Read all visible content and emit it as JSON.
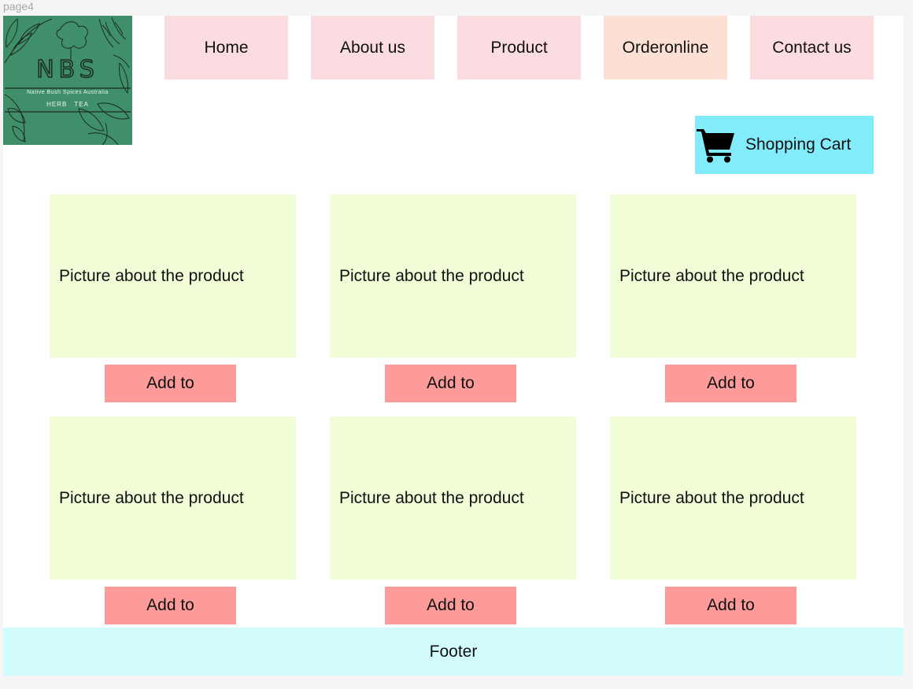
{
  "frame": {
    "label": "page4"
  },
  "logo": {
    "brand": "NBS",
    "tagline": "Native Bush Spices Australia",
    "subtitle": "HERB TEA"
  },
  "nav": {
    "items": [
      {
        "label": "Home"
      },
      {
        "label": "About us"
      },
      {
        "label": "Product"
      },
      {
        "label": "Orderonline"
      },
      {
        "label": "Contact us"
      }
    ]
  },
  "cart": {
    "label": "Shopping Cart",
    "icon": "shopping-cart-icon"
  },
  "products": [
    {
      "placeholder": "Picture about the product",
      "button": "Add to"
    },
    {
      "placeholder": "Picture about the product",
      "button": "Add to"
    },
    {
      "placeholder": "Picture about the product",
      "button": "Add to"
    },
    {
      "placeholder": "Picture about the product",
      "button": "Add to"
    },
    {
      "placeholder": "Picture about the product",
      "button": "Add to"
    },
    {
      "placeholder": "Picture about the product",
      "button": "Add to"
    }
  ],
  "footer": {
    "label": "Footer"
  },
  "colors": {
    "nav": "#fbdde1",
    "nav_active": "#fbe0d3",
    "cart": "#83ecfb",
    "card": "#f1fdd7",
    "add_button": "#fd9a9a",
    "footer": "#d2fcfc",
    "logo": "#3f8f6a"
  }
}
